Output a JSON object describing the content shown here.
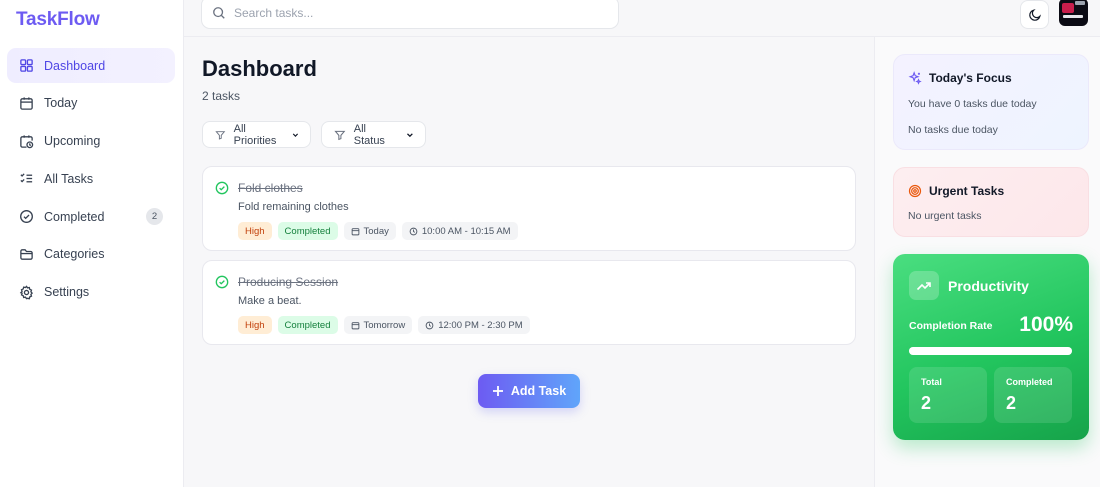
{
  "app": {
    "brand": "TaskFlow"
  },
  "sidebar": {
    "items": [
      {
        "label": "Dashboard",
        "icon": "grid-icon",
        "active": true
      },
      {
        "label": "Today",
        "icon": "calendar-icon"
      },
      {
        "label": "Upcoming",
        "icon": "calendar-clock-icon"
      },
      {
        "label": "All Tasks",
        "icon": "list-checks-icon"
      },
      {
        "label": "Completed",
        "icon": "check-circle-icon",
        "badge": "2"
      },
      {
        "label": "Categories",
        "icon": "folder-icon"
      },
      {
        "label": "Settings",
        "icon": "gear-icon"
      }
    ]
  },
  "header": {
    "search_placeholder": "Search tasks...",
    "search_value": ""
  },
  "main": {
    "title": "Dashboard",
    "subtitle": "2 tasks",
    "filters": {
      "priority": "All Priorities",
      "status": "All Status"
    },
    "tasks": [
      {
        "title": "Fold clothes",
        "description": "Fold remaining clothes",
        "priority": "High",
        "status": "Completed",
        "date": "Today",
        "time": "10:00 AM - 10:15 AM"
      },
      {
        "title": "Producing Session",
        "description": "Make a beat.",
        "priority": "High",
        "status": "Completed",
        "date": "Tomorrow",
        "time": "12:00 PM - 2:30 PM"
      }
    ],
    "add_task_label": "Add Task"
  },
  "right": {
    "focus": {
      "title": "Today's Focus",
      "line1": "You have 0 tasks due today",
      "line2": "No tasks due today"
    },
    "urgent": {
      "title": "Urgent Tasks",
      "line": "No urgent tasks"
    },
    "productivity": {
      "title": "Productivity",
      "rate_label": "Completion Rate",
      "rate_value": "100%",
      "rate_fraction": 1.0,
      "total_label": "Total",
      "total_value": "2",
      "completed_label": "Completed",
      "completed_value": "2"
    }
  },
  "colors": {
    "brand": "#6d5bf2",
    "success": "#22c55e",
    "high_priority": "#c2410c"
  }
}
